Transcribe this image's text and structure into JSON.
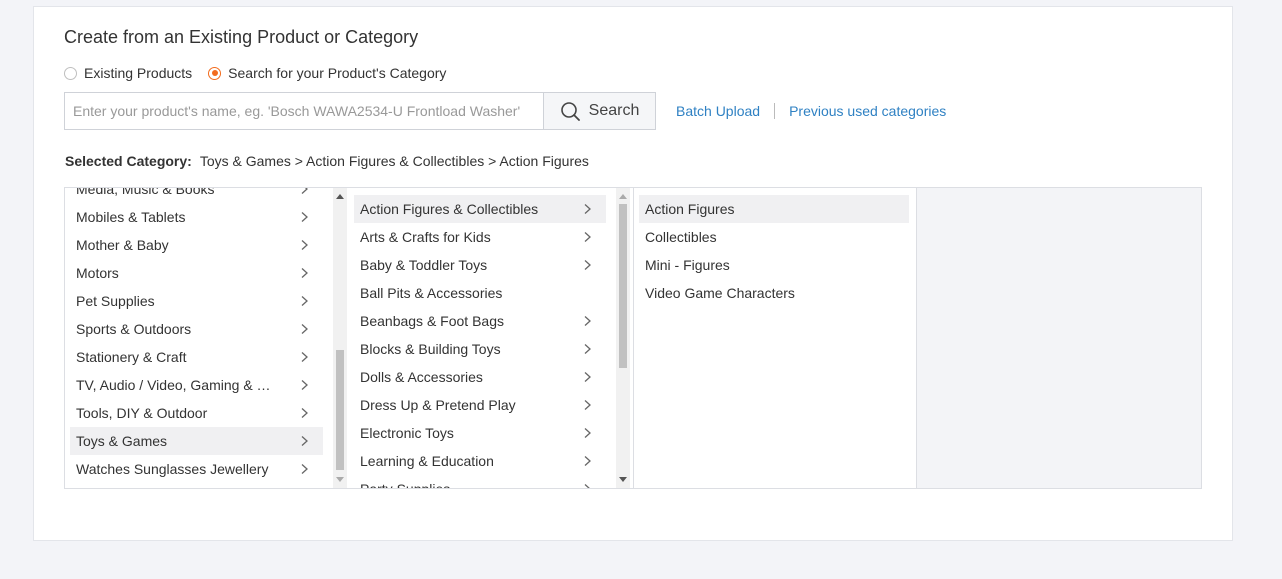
{
  "page": {
    "title": "Create from an Existing Product or Category",
    "accent_color": "#f26b1d",
    "link_color": "#2f81c3"
  },
  "mode": {
    "options": [
      {
        "label": "Existing Products",
        "selected": false
      },
      {
        "label": "Search for your Product's Category",
        "selected": true
      }
    ]
  },
  "search": {
    "placeholder": "Enter your product's name, eg. 'Bosch WAWA2534-U Frontload Washer'",
    "value": "",
    "button_label": "Search",
    "button_icon": "search-icon"
  },
  "links": {
    "batch_upload": "Batch Upload",
    "previous_categories": "Previous used categories"
  },
  "selected_category": {
    "label": "Selected Category:",
    "path": "Toys & Games > Action Figures & Collectibles > Action Figures"
  },
  "columns": {
    "level1": [
      {
        "label": "Media, Music & Books",
        "has_children": true
      },
      {
        "label": "Mobiles & Tablets",
        "has_children": true
      },
      {
        "label": "Mother & Baby",
        "has_children": true
      },
      {
        "label": "Motors",
        "has_children": true
      },
      {
        "label": "Pet Supplies",
        "has_children": true
      },
      {
        "label": "Sports & Outdoors",
        "has_children": true
      },
      {
        "label": "Stationery & Craft",
        "has_children": true
      },
      {
        "label": "TV, Audio / Video, Gaming & …",
        "has_children": true
      },
      {
        "label": "Tools, DIY & Outdoor",
        "has_children": true
      },
      {
        "label": "Toys & Games",
        "has_children": true,
        "active": true
      },
      {
        "label": "Watches Sunglasses Jewellery",
        "has_children": true
      }
    ],
    "level2": [
      {
        "label": "Action Figures & Collectibles",
        "has_children": true,
        "active": true
      },
      {
        "label": "Arts & Crafts for Kids",
        "has_children": true
      },
      {
        "label": "Baby & Toddler Toys",
        "has_children": true
      },
      {
        "label": "Ball Pits & Accessories",
        "has_children": false
      },
      {
        "label": "Beanbags & Foot Bags",
        "has_children": true
      },
      {
        "label": "Blocks & Building Toys",
        "has_children": true
      },
      {
        "label": "Dolls & Accessories",
        "has_children": true
      },
      {
        "label": "Dress Up & Pretend Play",
        "has_children": true
      },
      {
        "label": "Electronic Toys",
        "has_children": true
      },
      {
        "label": "Learning & Education",
        "has_children": true
      },
      {
        "label": "Party Supplies",
        "has_children": true
      }
    ],
    "level3": [
      {
        "label": "Action Figures",
        "active": true
      },
      {
        "label": "Collectibles"
      },
      {
        "label": "Mini - Figures"
      },
      {
        "label": "Video Game Characters"
      }
    ]
  }
}
